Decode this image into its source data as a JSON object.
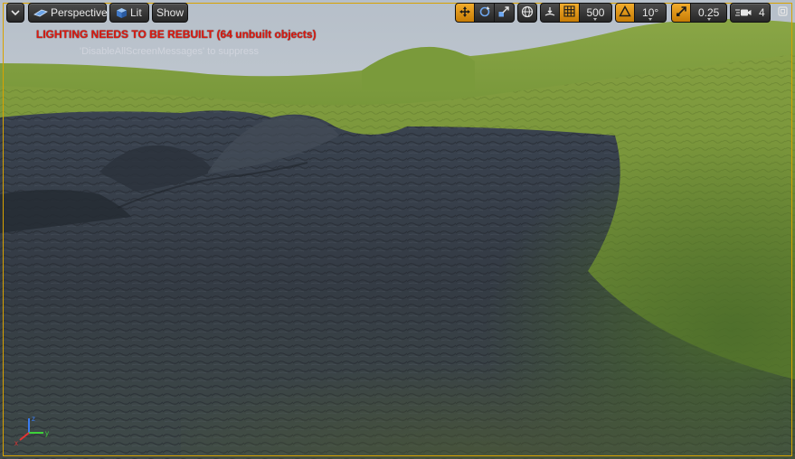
{
  "toolbar": {
    "view_mode_label": "Perspective",
    "lit_label": "Lit",
    "show_label": "Show",
    "grid_snap_value": "500",
    "rotation_snap_value": "10°",
    "scale_snap_value": "0.25",
    "camera_speed_value": "4"
  },
  "messages": {
    "lighting_warning": "LIGHTING NEEDS TO BE REBUILT (64 unbuilt objects)",
    "suppress_hint": "'DisableAllScreenMessages' to suppress"
  },
  "axis": {
    "x": "x",
    "y": "y",
    "z": "z"
  },
  "colors": {
    "accent": "#e8a015",
    "warning": "#e01a10",
    "viewport_border": "#d8a200"
  },
  "icons": {
    "viewport_menu": "chevron-down-icon",
    "perspective": "perspective-cube-icon",
    "lit": "lit-cube-icon",
    "translate": "translate-cross-arrows-icon",
    "rotate": "rotate-icon",
    "scale": "scale-icon",
    "world_local": "globe-icon",
    "surface_snap": "surface-snap-icon",
    "grid_snap": "grid-icon",
    "rotation_snap": "angle-icon",
    "scale_snap": "scale-arrow-icon",
    "camera_speed": "camera-speed-icon",
    "maximize": "maximize-icon"
  }
}
